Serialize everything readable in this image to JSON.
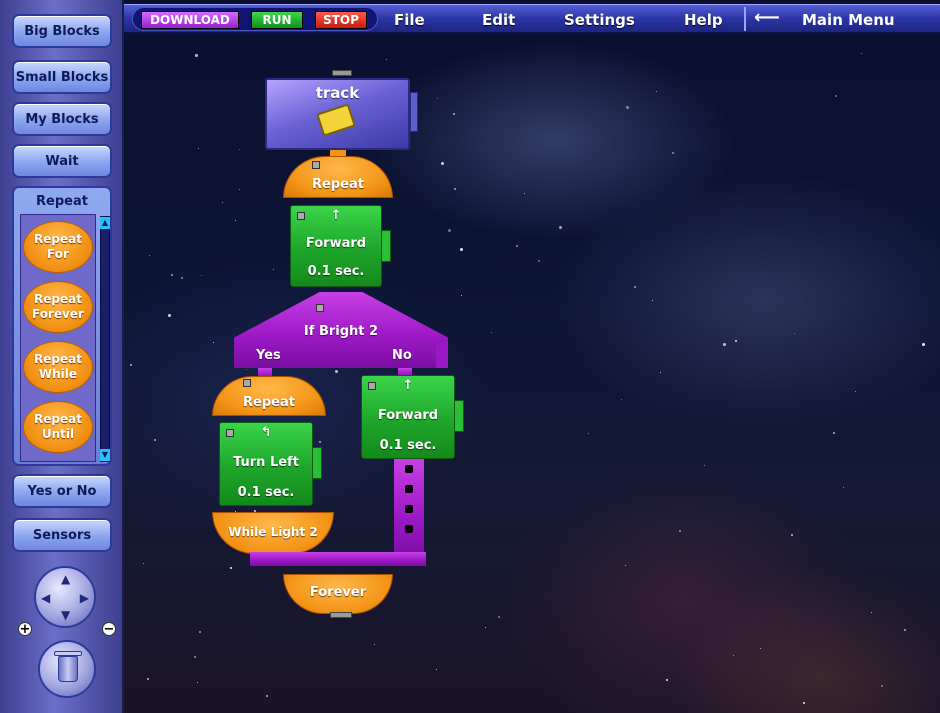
{
  "sidebar": {
    "big_blocks": "Big Blocks",
    "small_blocks": "Small Blocks",
    "my_blocks": "My Blocks",
    "wait": "Wait",
    "repeat_title": "Repeat",
    "repeat_items": [
      "Repeat\nFor",
      "Repeat\nForever",
      "Repeat\nWhile",
      "Repeat\nUntil"
    ],
    "yes_or_no": "Yes or No",
    "sensors": "Sensors"
  },
  "toolbar": {
    "download": "DOWNLOAD",
    "run": "RUN",
    "stop": "STOP",
    "file": "File",
    "edit": "Edit",
    "settings": "Settings",
    "help": "Help",
    "main_menu": "Main Menu"
  },
  "program": {
    "start_title": "track",
    "outer_repeat": "Repeat",
    "forward1_line1": "Forward",
    "forward1_line2": "0.1 sec.",
    "if_label": "If Bright 2",
    "yes": "Yes",
    "no": "No",
    "inner_repeat": "Repeat",
    "turn_left_line1": "Turn Left",
    "turn_left_line2": "0.1 sec.",
    "while_label": "While Light 2",
    "forward2_line1": "Forward",
    "forward2_line2": "0.1 sec.",
    "forever": "Forever"
  },
  "colors": {
    "accent": "#2b35a6",
    "repeat_orange": "#f39417",
    "move_green": "#1ea62a",
    "decision_purple": "#9a18c4"
  }
}
